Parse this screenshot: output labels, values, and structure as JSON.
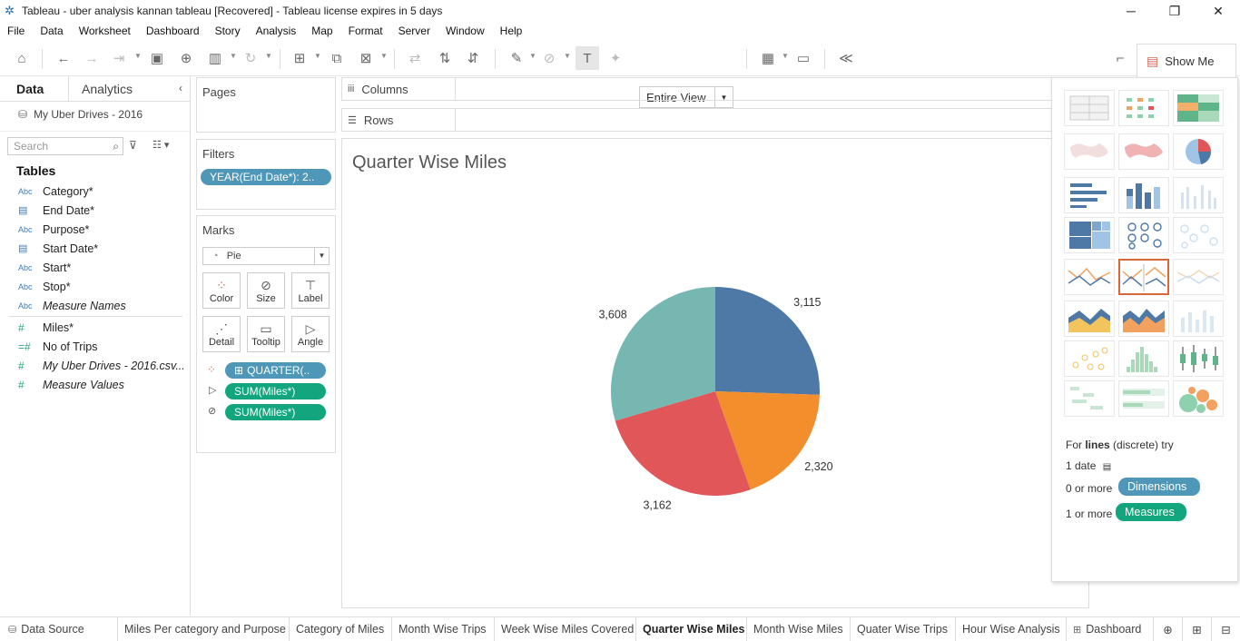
{
  "window": {
    "title": "Tableau - uber analysis kannan tableau [Recovered] - Tableau license expires in 5 days"
  },
  "menu": [
    "File",
    "Data",
    "Worksheet",
    "Dashboard",
    "Story",
    "Analysis",
    "Map",
    "Format",
    "Server",
    "Window",
    "Help"
  ],
  "toolbar": {
    "view_select": "Entire View",
    "show_me_label": "Show Me"
  },
  "left_panel": {
    "tab_data": "Data",
    "tab_analytics": "Analytics",
    "datasource": "My Uber Drives - 2016",
    "search_placeholder": "Search",
    "tables_label": "Tables",
    "dimensions": [
      {
        "type": "Abc",
        "name": "Category*"
      },
      {
        "type": "date",
        "name": "End Date*"
      },
      {
        "type": "Abc",
        "name": "Purpose*"
      },
      {
        "type": "date",
        "name": "Start Date*"
      },
      {
        "type": "Abc",
        "name": "Start*"
      },
      {
        "type": "Abc",
        "name": "Stop*"
      },
      {
        "type": "Abc",
        "name": "Measure Names"
      }
    ],
    "measures": [
      {
        "type": "#",
        "name": "Miles*"
      },
      {
        "type": "#",
        "name": "No of Trips"
      },
      {
        "type": "#",
        "name": "My Uber Drives - 2016.csv..."
      },
      {
        "type": "#",
        "name": "Measure Values"
      }
    ]
  },
  "pages": {
    "label": "Pages"
  },
  "filters": {
    "label": "Filters",
    "pill": "YEAR(End Date*): 2.."
  },
  "marks": {
    "label": "Marks",
    "type": "Pie",
    "buttons": [
      "Color",
      "Size",
      "Label",
      "Detail",
      "Tooltip",
      "Angle"
    ],
    "pills": [
      "QUARTER(..",
      "SUM(Miles*)",
      "SUM(Miles*)"
    ]
  },
  "shelves": {
    "columns": "Columns",
    "rows": "Rows"
  },
  "sheet": {
    "title": "Quarter Wise Miles"
  },
  "chart_data": {
    "type": "pie",
    "title": "Quarter Wise Miles",
    "slices": [
      {
        "value": 3115,
        "label": "3,115",
        "color": "#4e79a7"
      },
      {
        "value": 2320,
        "label": "2,320",
        "color": "#f28e2b"
      },
      {
        "value": 3162,
        "label": "3,162",
        "color": "#e15759"
      },
      {
        "value": 3608,
        "label": "3,608",
        "color": "#76b7b2"
      }
    ]
  },
  "show_me": {
    "hint_prefix": "For",
    "hint_bold": "lines",
    "hint_suffix": "(discrete) try",
    "req1": "1 date",
    "req2_prefix": "0 or more",
    "req2_pill": "Dimensions",
    "req3_prefix": "1 or more",
    "req3_pill": "Measures"
  },
  "tabs": [
    "Data Source",
    "Miles Per category and Purpose",
    "Category of Miles",
    "Month Wise Trips",
    "Week Wise Miles Covered",
    "Quarter Wise Miles",
    "Month Wise Miles",
    "Quater Wise Trips",
    "Hour Wise Analysis",
    "Dashboard"
  ]
}
